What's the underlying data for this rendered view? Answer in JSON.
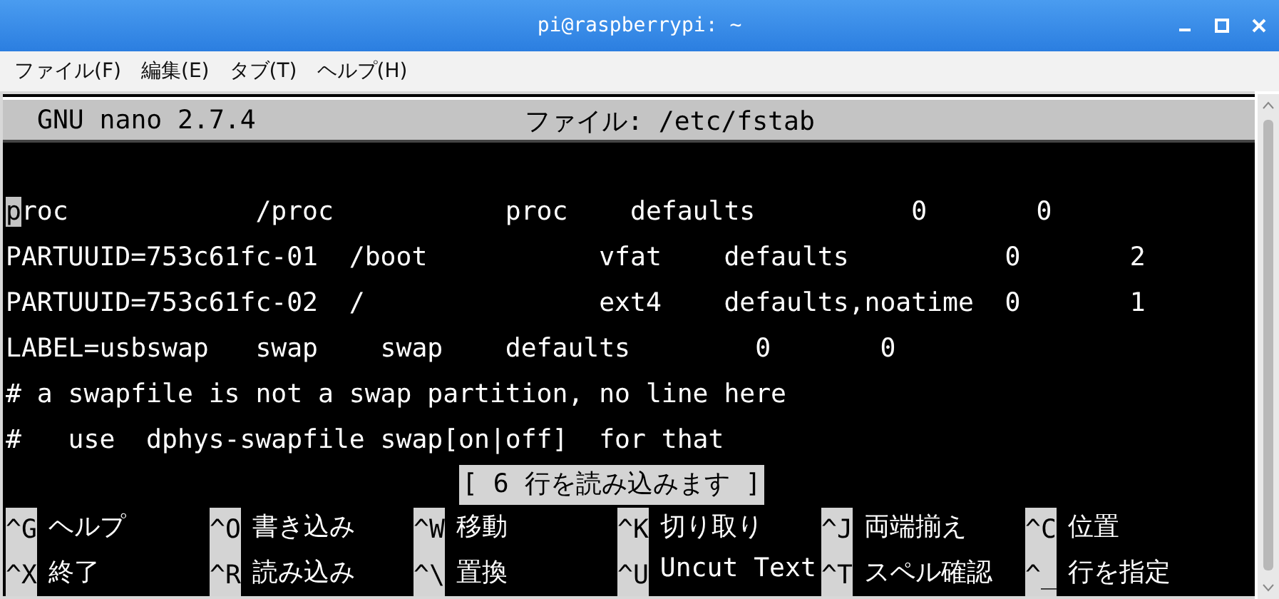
{
  "window": {
    "title": "pi@raspberrypi: ~"
  },
  "menu": [
    "ファイル(F)",
    "編集(E)",
    "タブ(T)",
    "ヘルプ(H)"
  ],
  "nano": {
    "version": "GNU nano 2.7.4",
    "file": "ファイル: /etc/fstab"
  },
  "lines": [
    {
      "text": "proc            /proc           proc    defaults          0       0",
      "cursor": true
    },
    {
      "text": "PARTUUID=753c61fc-01  /boot           vfat    defaults          0       2",
      "cursor": false
    },
    {
      "text": "PARTUUID=753c61fc-02  /               ext4    defaults,noatime  0       1",
      "cursor": false
    },
    {
      "text": "LABEL=usbswap   swap    swap    defaults        0       0",
      "cursor": false
    },
    {
      "text": "# a swapfile is not a swap partition, no line here",
      "cursor": false
    },
    {
      "text": "#   use  dphys-swapfile swap[on|off]  for that",
      "cursor": false
    }
  ],
  "status": "[ 6 行を読み込みます ]",
  "shortcuts": [
    [
      {
        "key": "^G",
        "label": "ヘルプ"
      },
      {
        "key": "^O",
        "label": "書き込み"
      },
      {
        "key": "^W",
        "label": "移動"
      },
      {
        "key": "^K",
        "label": "切り取り"
      },
      {
        "key": "^J",
        "label": "両端揃え"
      },
      {
        "key": "^C",
        "label": "位置"
      }
    ],
    [
      {
        "key": "^X",
        "label": "終了"
      },
      {
        "key": "^R",
        "label": "読み込み"
      },
      {
        "key": "^\\",
        "label": "置換"
      },
      {
        "key": "^U",
        "label": "Uncut Text"
      },
      {
        "key": "^T",
        "label": "スペル確認"
      },
      {
        "key": "^_",
        "label": "行を指定"
      }
    ]
  ]
}
